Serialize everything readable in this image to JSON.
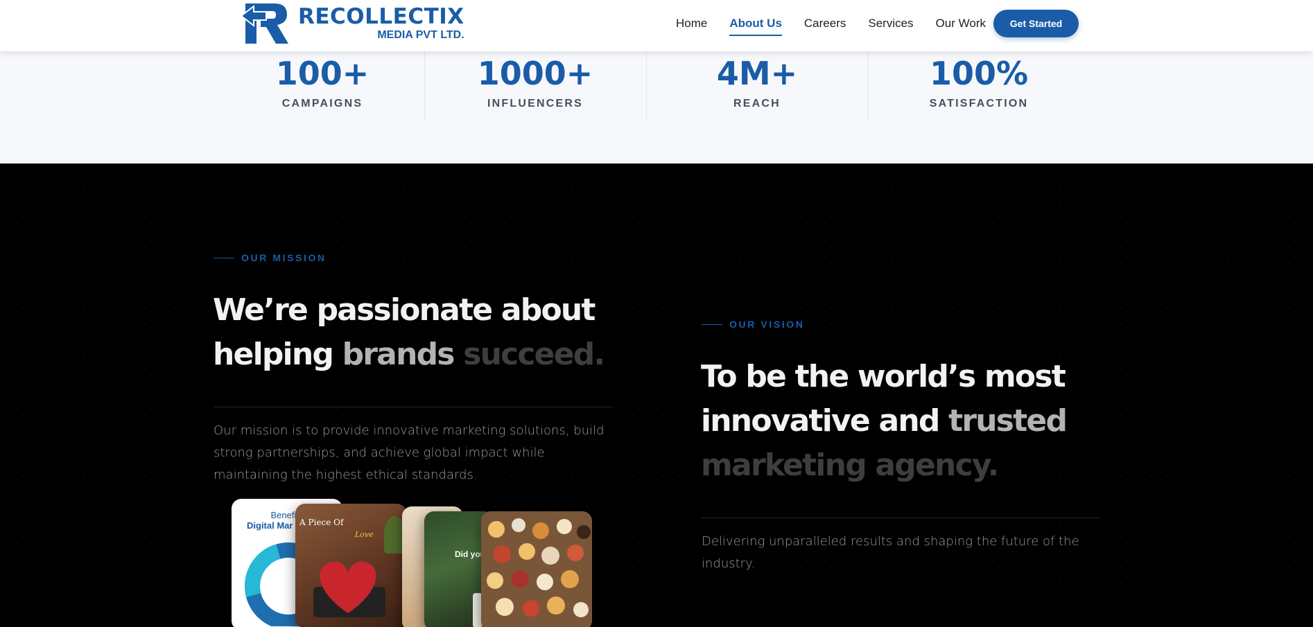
{
  "brand": {
    "name": "RECOLLECTIX",
    "subtitle": "MEDIA PVT LTD.",
    "color": "#1a5ca8"
  },
  "nav": {
    "items": [
      {
        "label": "Home",
        "active": false
      },
      {
        "label": "About Us",
        "active": true
      },
      {
        "label": "Careers",
        "active": false
      },
      {
        "label": "Services",
        "active": false
      },
      {
        "label": "Our Work",
        "active": false
      }
    ],
    "cta_label": "Get Started"
  },
  "stats": [
    {
      "value": "100+",
      "label": "CAMPAIGNS"
    },
    {
      "value": "1000+",
      "label": "INFLUENCERS"
    },
    {
      "value": "4M+",
      "label": "REACH"
    },
    {
      "value": "100%",
      "label": "SATISFACTION"
    }
  ],
  "mission": {
    "eyebrow": "OUR MISSION",
    "heading_line1": "We’re passionate about",
    "heading_line2_start": "helping ",
    "heading_line2_mid": "brands",
    "heading_line2_dim": " succeed.",
    "text": "Our mission is to provide innovative marketing solutions, build strong partnerships, and achieve global impact while maintaining the highest ethical standards."
  },
  "vision": {
    "eyebrow": "OUR VISION",
    "heading_line1": "To be the world’s most",
    "heading_line2_start": "innovative and ",
    "heading_line2_mid": "trusted",
    "heading_line3_dim": "marketing agency.",
    "text": "Delivering unparalleled results and shaping the future of the industry."
  },
  "collage": {
    "card1_title_a": "Benefits",
    "card1_title_b": "Digital Mar",
    "card2_title": "A Piece Of",
    "card2_script": "Love",
    "card3_title": "Did you"
  },
  "colors": {
    "accent": "#1a5ca8",
    "dark_bg": "#000000",
    "stats_bg": "#f6f8fb"
  }
}
